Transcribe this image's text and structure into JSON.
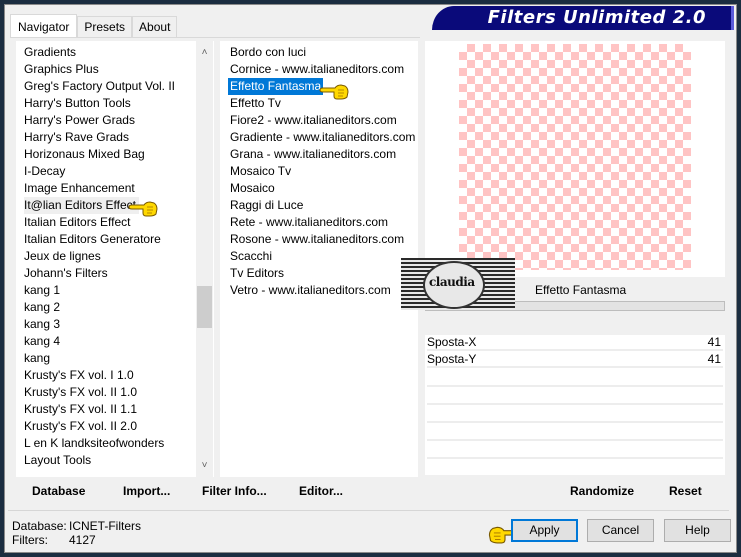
{
  "window": {
    "banner_title": "Filters Unlimited 2.0"
  },
  "tabs": [
    {
      "label": "Navigator",
      "active": true
    },
    {
      "label": "Presets",
      "active": false
    },
    {
      "label": "About",
      "active": false
    }
  ],
  "categories": {
    "items": [
      "Gradients",
      "Graphics Plus",
      "Greg's Factory Output Vol. II",
      "Harry's Button Tools",
      "Harry's Power Grads",
      "Harry's Rave Grads",
      "Horizonaus Mixed Bag",
      "I-Decay",
      "Image Enhancement",
      "It@lian Editors Effect",
      "Italian Editors Effect",
      "Italian Editors Generatore",
      "Jeux de lignes",
      "Johann's Filters",
      "kang 1",
      "kang 2",
      "kang 3",
      "kang 4",
      "kang",
      "Krusty's FX vol. I 1.0",
      "Krusty's FX vol. II 1.0",
      "Krusty's FX vol. II 1.1",
      "Krusty's FX vol. II 2.0",
      "L en K landksiteofwonders",
      "Layout Tools"
    ],
    "highlighted": "It@lian Editors Effect",
    "scroll_up_icon": "chevron-up",
    "scroll_down_icon": "chevron-down"
  },
  "filters": {
    "items": [
      "Bordo con luci",
      "Cornice - www.italianeditors.com",
      "Effetto Fantasma",
      "Effetto Tv",
      "Fiore2 - www.italianeditors.com",
      "Gradiente - www.italianeditors.com",
      "Grana - www.italianeditors.com",
      "Mosaico Tv",
      "Mosaico",
      "Raggi di Luce",
      "Rete - www.italianeditors.com",
      "Rosone - www.italianeditors.com",
      "Scacchi",
      "Tv Editors",
      "Vetro - www.italianeditors.com"
    ],
    "selected": "Effetto Fantasma"
  },
  "preview": {
    "checker_color": "#ffc4c4",
    "watermark_text": "claudia"
  },
  "filter_panel": {
    "name": "Effetto Fantasma",
    "params": [
      {
        "label": "Sposta-X",
        "value": "41"
      },
      {
        "label": "Sposta-Y",
        "value": "41"
      }
    ]
  },
  "left_buttons": {
    "database": "Database",
    "import": "Import...",
    "filter_info": "Filter Info...",
    "editor": "Editor..."
  },
  "right_buttons": {
    "randomize": "Randomize",
    "reset": "Reset"
  },
  "status": {
    "database_label": "Database:",
    "database_value": "ICNET-Filters",
    "filters_label": "Filters:",
    "filters_value": "4127"
  },
  "dialog_buttons": {
    "apply": "Apply",
    "cancel": "Cancel",
    "help": "Help"
  },
  "colors": {
    "selection": "#0078d7",
    "banner": "#0a0a7a",
    "frame": "#1b2d40"
  }
}
